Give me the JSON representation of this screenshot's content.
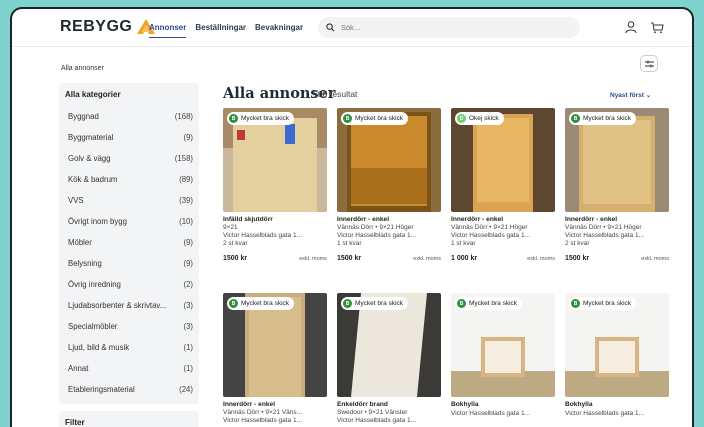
{
  "header": {
    "logo": "REBYGG",
    "nav": [
      "Annonser",
      "Beställningar",
      "Bevakningar"
    ],
    "search_placeholder": "Sök..."
  },
  "breadcrumb": "Alla annonser",
  "sidebar": {
    "heading": "Alla kategorier",
    "items": [
      {
        "label": "Byggnad",
        "count": "(168)"
      },
      {
        "label": "Byggmaterial",
        "count": "(9)"
      },
      {
        "label": "Golv & vägg",
        "count": "(158)"
      },
      {
        "label": "Kök & badrum",
        "count": "(89)"
      },
      {
        "label": "VVS",
        "count": "(39)"
      },
      {
        "label": "Övrigt inom bygg",
        "count": "(10)"
      },
      {
        "label": "Möbler",
        "count": "(9)"
      },
      {
        "label": "Belysning",
        "count": "(9)"
      },
      {
        "label": "Övrig inredning",
        "count": "(2)"
      },
      {
        "label": "Ljudabsorbenter & skrivtav...",
        "count": "(3)"
      },
      {
        "label": "Specialmöbler",
        "count": "(3)"
      },
      {
        "label": "Ljud, bild & musik",
        "count": "(1)"
      },
      {
        "label": "Annat",
        "count": "(1)"
      },
      {
        "label": "Etableringsmaterial",
        "count": "(24)"
      }
    ],
    "filter_heading": "Filter"
  },
  "main": {
    "title": "Alla annonser",
    "result_count": "508 resultat",
    "sort": "Nyast först"
  },
  "colors": {
    "badge_green": "#2f8f3e",
    "badge_light_green": "#6fcf73",
    "nav_active": "#2f4a8a"
  },
  "listings": [
    {
      "badge_letter": "B",
      "badge": "Mycket bra skick",
      "title": "Infälld skjutdörr",
      "sub": "9×21",
      "addr": "Victor Hasselblads gata 1...",
      "stock": "2 st kvar",
      "price": "1500 kr",
      "moms": "exkl. moms"
    },
    {
      "badge_letter": "B",
      "badge": "Mycket bra skick",
      "title": "Innerdörr - enkel",
      "sub": "Vännäs Dörr • 9×21 Höger",
      "addr": "Victor Hasselblads gata 1...",
      "stock": "1 st kvar",
      "price": "1500 kr",
      "moms": "exkl. moms"
    },
    {
      "badge_letter": "D",
      "badge": "Okej skick",
      "title": "Innerdörr - enkel",
      "sub": "Vännäs Dörr • 9×21 Höger",
      "addr": "Victor Hasselblads gata 1...",
      "stock": "1 st kvar",
      "price": "1 000 kr",
      "moms": "exkl. moms"
    },
    {
      "badge_letter": "B",
      "badge": "Mycket bra skick",
      "title": "Innerdörr - enkel",
      "sub": "Vännäs Dörr • 9×21 Höger",
      "addr": "Victor Hasselblads gata 1...",
      "stock": "2 st kvar",
      "price": "1500 kr",
      "moms": "exkl. moms"
    },
    {
      "badge_letter": "B",
      "badge": "Mycket bra skick",
      "title": "Innerdörr - enkel",
      "sub": "Vännäs Dörr • 9×21 Väns...",
      "addr": "Victor Hasselblads gata 1...",
      "stock": "",
      "price": "",
      "moms": ""
    },
    {
      "badge_letter": "B",
      "badge": "Mycket bra skick",
      "title": "Enkeldörr brand",
      "sub": "Swedoor • 9×21 Vänster",
      "addr": "Victor Hasselblads gata 1...",
      "stock": "",
      "price": "",
      "moms": ""
    },
    {
      "badge_letter": "B",
      "badge": "Mycket bra skick",
      "title": "Bokhylla",
      "sub": "",
      "addr": "Victor Hasselblads gata 1...",
      "stock": "",
      "price": "",
      "moms": ""
    },
    {
      "badge_letter": "B",
      "badge": "Mycket bra skick",
      "title": "Bokhylla",
      "sub": "",
      "addr": "Victor Hasselblads gata 1...",
      "stock": "",
      "price": "",
      "moms": ""
    }
  ]
}
